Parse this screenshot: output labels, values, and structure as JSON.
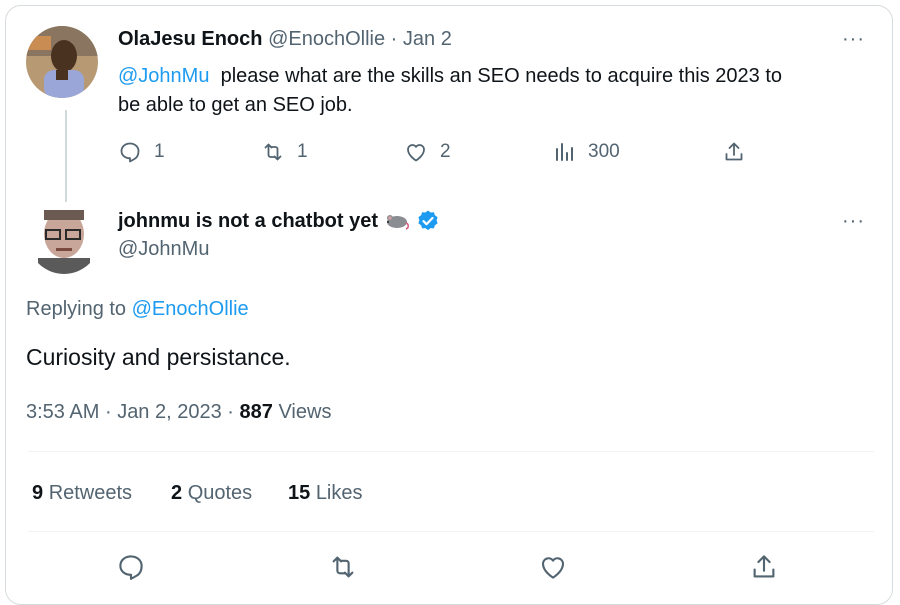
{
  "parent_tweet": {
    "author_name": "OlaJesu Enoch",
    "handle": "@EnochOllie",
    "separator": "·",
    "date": "Jan 2",
    "more": "···",
    "mention": "@JohnMu",
    "text_line1": "please what are the skills an SEO needs to acquire this 2023 to",
    "text_line2": "be able to get an SEO job.",
    "replies": "1",
    "retweets": "1",
    "likes": "2",
    "views": "300"
  },
  "main_tweet": {
    "author_name": "johnmu is not a chatbot yet",
    "handle": "@JohnMu",
    "more": "···",
    "replying_prefix": "Replying to",
    "replying_to": "@EnochOllie",
    "text": "Curiosity and persistance.",
    "time": "3:53 AM",
    "sep1": "·",
    "date": "Jan 2, 2023",
    "sep2": "·",
    "views_count": "887",
    "views_label": "Views",
    "retweets_count": "9",
    "retweets_label": "Retweets",
    "quotes_count": "2",
    "quotes_label": "Quotes",
    "likes_count": "15",
    "likes_label": "Likes"
  },
  "icons": {
    "reply": "reply-icon",
    "retweet": "retweet-icon",
    "like": "heart-icon",
    "views": "views-icon",
    "share": "share-icon",
    "verified": "verified-badge-icon",
    "emoji": "mouse-emoji-icon"
  },
  "colors": {
    "accent": "#1d9bf0",
    "muted": "#536471",
    "text": "#0f1419"
  }
}
